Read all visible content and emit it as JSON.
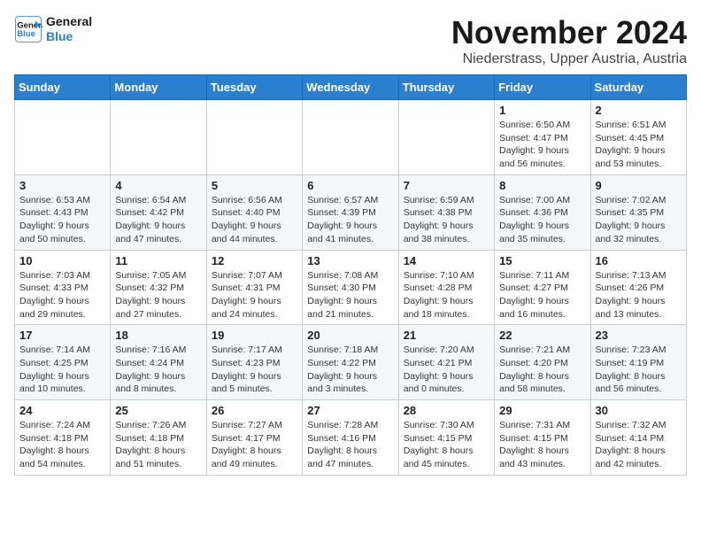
{
  "header": {
    "logo_line1": "General",
    "logo_line2": "Blue",
    "month": "November 2024",
    "location": "Niederstrass, Upper Austria, Austria"
  },
  "weekdays": [
    "Sunday",
    "Monday",
    "Tuesday",
    "Wednesday",
    "Thursday",
    "Friday",
    "Saturday"
  ],
  "weeks": [
    [
      {
        "day": "",
        "content": ""
      },
      {
        "day": "",
        "content": ""
      },
      {
        "day": "",
        "content": ""
      },
      {
        "day": "",
        "content": ""
      },
      {
        "day": "",
        "content": ""
      },
      {
        "day": "1",
        "content": "Sunrise: 6:50 AM\nSunset: 4:47 PM\nDaylight: 9 hours and 56 minutes."
      },
      {
        "day": "2",
        "content": "Sunrise: 6:51 AM\nSunset: 4:45 PM\nDaylight: 9 hours and 53 minutes."
      }
    ],
    [
      {
        "day": "3",
        "content": "Sunrise: 6:53 AM\nSunset: 4:43 PM\nDaylight: 9 hours and 50 minutes."
      },
      {
        "day": "4",
        "content": "Sunrise: 6:54 AM\nSunset: 4:42 PM\nDaylight: 9 hours and 47 minutes."
      },
      {
        "day": "5",
        "content": "Sunrise: 6:56 AM\nSunset: 4:40 PM\nDaylight: 9 hours and 44 minutes."
      },
      {
        "day": "6",
        "content": "Sunrise: 6:57 AM\nSunset: 4:39 PM\nDaylight: 9 hours and 41 minutes."
      },
      {
        "day": "7",
        "content": "Sunrise: 6:59 AM\nSunset: 4:38 PM\nDaylight: 9 hours and 38 minutes."
      },
      {
        "day": "8",
        "content": "Sunrise: 7:00 AM\nSunset: 4:36 PM\nDaylight: 9 hours and 35 minutes."
      },
      {
        "day": "9",
        "content": "Sunrise: 7:02 AM\nSunset: 4:35 PM\nDaylight: 9 hours and 32 minutes."
      }
    ],
    [
      {
        "day": "10",
        "content": "Sunrise: 7:03 AM\nSunset: 4:33 PM\nDaylight: 9 hours and 29 minutes."
      },
      {
        "day": "11",
        "content": "Sunrise: 7:05 AM\nSunset: 4:32 PM\nDaylight: 9 hours and 27 minutes."
      },
      {
        "day": "12",
        "content": "Sunrise: 7:07 AM\nSunset: 4:31 PM\nDaylight: 9 hours and 24 minutes."
      },
      {
        "day": "13",
        "content": "Sunrise: 7:08 AM\nSunset: 4:30 PM\nDaylight: 9 hours and 21 minutes."
      },
      {
        "day": "14",
        "content": "Sunrise: 7:10 AM\nSunset: 4:28 PM\nDaylight: 9 hours and 18 minutes."
      },
      {
        "day": "15",
        "content": "Sunrise: 7:11 AM\nSunset: 4:27 PM\nDaylight: 9 hours and 16 minutes."
      },
      {
        "day": "16",
        "content": "Sunrise: 7:13 AM\nSunset: 4:26 PM\nDaylight: 9 hours and 13 minutes."
      }
    ],
    [
      {
        "day": "17",
        "content": "Sunrise: 7:14 AM\nSunset: 4:25 PM\nDaylight: 9 hours and 10 minutes."
      },
      {
        "day": "18",
        "content": "Sunrise: 7:16 AM\nSunset: 4:24 PM\nDaylight: 9 hours and 8 minutes."
      },
      {
        "day": "19",
        "content": "Sunrise: 7:17 AM\nSunset: 4:23 PM\nDaylight: 9 hours and 5 minutes."
      },
      {
        "day": "20",
        "content": "Sunrise: 7:18 AM\nSunset: 4:22 PM\nDaylight: 9 hours and 3 minutes."
      },
      {
        "day": "21",
        "content": "Sunrise: 7:20 AM\nSunset: 4:21 PM\nDaylight: 9 hours and 0 minutes."
      },
      {
        "day": "22",
        "content": "Sunrise: 7:21 AM\nSunset: 4:20 PM\nDaylight: 8 hours and 58 minutes."
      },
      {
        "day": "23",
        "content": "Sunrise: 7:23 AM\nSunset: 4:19 PM\nDaylight: 8 hours and 56 minutes."
      }
    ],
    [
      {
        "day": "24",
        "content": "Sunrise: 7:24 AM\nSunset: 4:18 PM\nDaylight: 8 hours and 54 minutes."
      },
      {
        "day": "25",
        "content": "Sunrise: 7:26 AM\nSunset: 4:18 PM\nDaylight: 8 hours and 51 minutes."
      },
      {
        "day": "26",
        "content": "Sunrise: 7:27 AM\nSunset: 4:17 PM\nDaylight: 8 hours and 49 minutes."
      },
      {
        "day": "27",
        "content": "Sunrise: 7:28 AM\nSunset: 4:16 PM\nDaylight: 8 hours and 47 minutes."
      },
      {
        "day": "28",
        "content": "Sunrise: 7:30 AM\nSunset: 4:15 PM\nDaylight: 8 hours and 45 minutes."
      },
      {
        "day": "29",
        "content": "Sunrise: 7:31 AM\nSunset: 4:15 PM\nDaylight: 8 hours and 43 minutes."
      },
      {
        "day": "30",
        "content": "Sunrise: 7:32 AM\nSunset: 4:14 PM\nDaylight: 8 hours and 42 minutes."
      }
    ]
  ]
}
